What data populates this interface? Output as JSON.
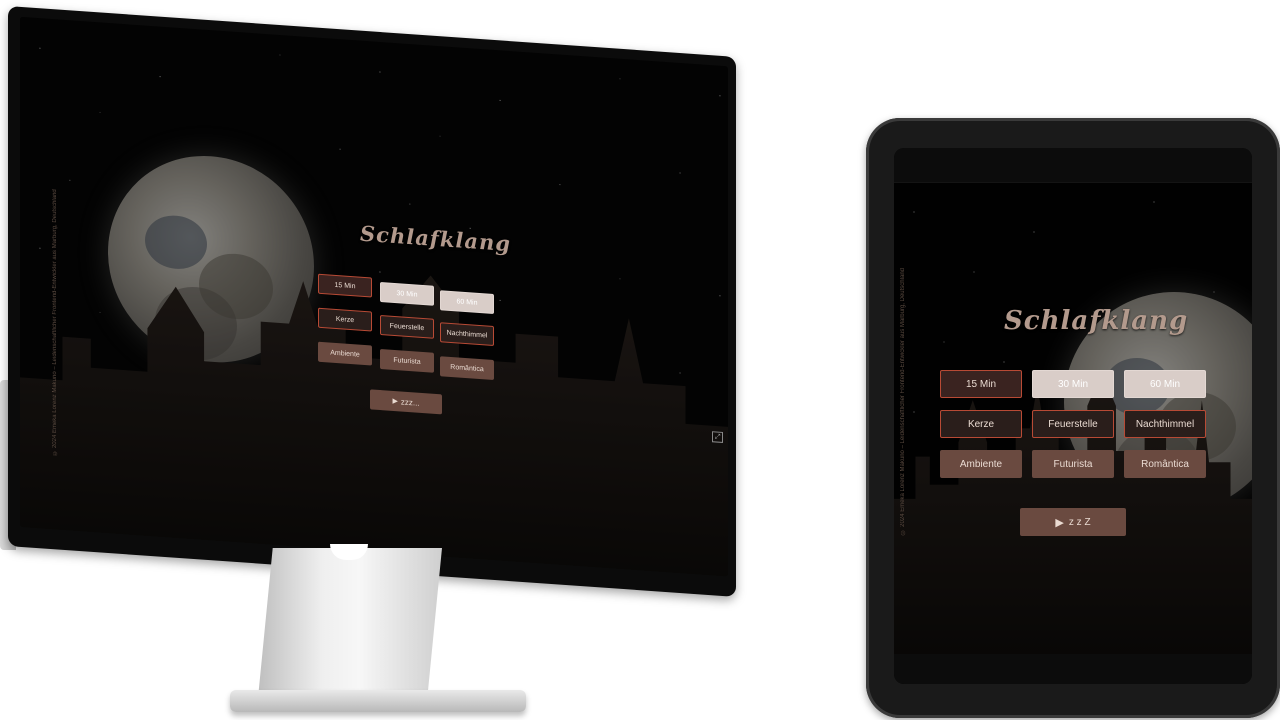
{
  "app": {
    "title": "Schlafklang",
    "credit": "© 2024 Emeka Lorenz Makuno – Leidenschaftlicher Frontend-Entwickler aus Marburg, Deutschland",
    "timers": [
      {
        "label": "15 Min",
        "state": "active"
      },
      {
        "label": "30 Min",
        "state": "inactive"
      },
      {
        "label": "60 Min",
        "state": "inactive"
      }
    ],
    "scenes": [
      "Kerze",
      "Feuerstelle",
      "Nachthimmel"
    ],
    "moods": [
      "Ambiente",
      "Futurista",
      "Romântica"
    ],
    "play_desktop": "zzz...",
    "play_tablet": "z z Z",
    "play_icon": "play-icon",
    "fullscreen_icon": "fullscreen-icon"
  },
  "colors": {
    "accent_border": "#b84a35",
    "button_fill": "#6a4a40",
    "title_color": "#b39a8d"
  }
}
